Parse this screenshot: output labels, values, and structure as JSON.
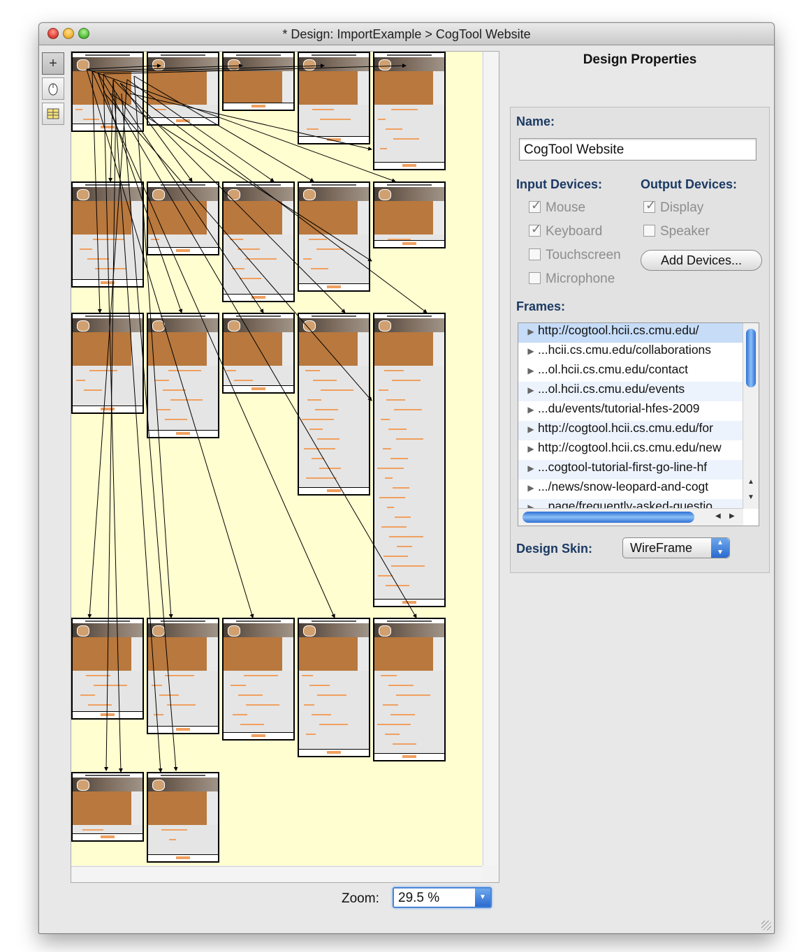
{
  "window": {
    "title": "* Design: ImportExample > CogTool Website"
  },
  "tools": [
    "plus-icon",
    "mouse-icon",
    "frame-grid-icon"
  ],
  "zoom": {
    "label": "Zoom:",
    "value": "29.5 %"
  },
  "properties": {
    "heading": "Design Properties",
    "name_label": "Name:",
    "name_value": "CogTool Website",
    "input_devices_label": "Input Devices:",
    "output_devices_label": "Output Devices:",
    "input_devices": [
      {
        "label": "Mouse",
        "checked": true
      },
      {
        "label": "Keyboard",
        "checked": true
      },
      {
        "label": "Touchscreen",
        "checked": false
      },
      {
        "label": "Microphone",
        "checked": false
      }
    ],
    "output_devices": [
      {
        "label": "Display",
        "checked": true
      },
      {
        "label": "Speaker",
        "checked": false
      }
    ],
    "add_devices_label": "Add Devices...",
    "frames_label": "Frames:",
    "frames": [
      "http://cogtool.hcii.cs.cmu.edu/",
      "...hcii.cs.cmu.edu/collaborations",
      "...ol.hcii.cs.cmu.edu/contact",
      "...ol.hcii.cs.cmu.edu/events",
      "...du/events/tutorial-hfes-2009",
      "http://cogtool.hcii.cs.cmu.edu/for",
      "http://cogtool.hcii.cs.cmu.edu/new",
      "...cogtool-tutorial-first-go-line-hf",
      ".../news/snow-leopard-and-cogt",
      "...page/frequently-asked-questio"
    ],
    "design_skin_label": "Design Skin:",
    "design_skin_value": "WireFrame"
  }
}
